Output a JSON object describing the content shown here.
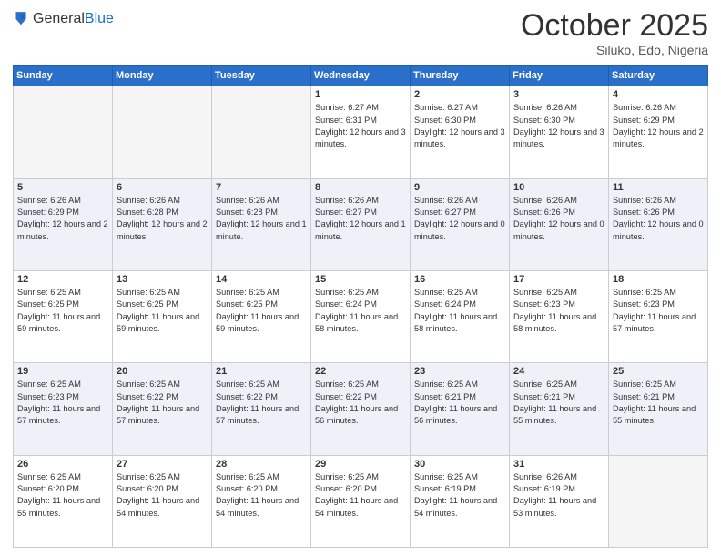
{
  "header": {
    "logo_line1": "General",
    "logo_line2": "Blue",
    "month": "October 2025",
    "location": "Siluko, Edo, Nigeria"
  },
  "weekdays": [
    "Sunday",
    "Monday",
    "Tuesday",
    "Wednesday",
    "Thursday",
    "Friday",
    "Saturday"
  ],
  "weeks": [
    [
      {
        "day": "",
        "sunrise": "",
        "sunset": "",
        "daylight": "",
        "empty": true
      },
      {
        "day": "",
        "sunrise": "",
        "sunset": "",
        "daylight": "",
        "empty": true
      },
      {
        "day": "",
        "sunrise": "",
        "sunset": "",
        "daylight": "",
        "empty": true
      },
      {
        "day": "1",
        "sunrise": "Sunrise: 6:27 AM",
        "sunset": "Sunset: 6:31 PM",
        "daylight": "Daylight: 12 hours and 3 minutes."
      },
      {
        "day": "2",
        "sunrise": "Sunrise: 6:27 AM",
        "sunset": "Sunset: 6:30 PM",
        "daylight": "Daylight: 12 hours and 3 minutes."
      },
      {
        "day": "3",
        "sunrise": "Sunrise: 6:26 AM",
        "sunset": "Sunset: 6:30 PM",
        "daylight": "Daylight: 12 hours and 3 minutes."
      },
      {
        "day": "4",
        "sunrise": "Sunrise: 6:26 AM",
        "sunset": "Sunset: 6:29 PM",
        "daylight": "Daylight: 12 hours and 2 minutes."
      }
    ],
    [
      {
        "day": "5",
        "sunrise": "Sunrise: 6:26 AM",
        "sunset": "Sunset: 6:29 PM",
        "daylight": "Daylight: 12 hours and 2 minutes."
      },
      {
        "day": "6",
        "sunrise": "Sunrise: 6:26 AM",
        "sunset": "Sunset: 6:28 PM",
        "daylight": "Daylight: 12 hours and 2 minutes."
      },
      {
        "day": "7",
        "sunrise": "Sunrise: 6:26 AM",
        "sunset": "Sunset: 6:28 PM",
        "daylight": "Daylight: 12 hours and 1 minute."
      },
      {
        "day": "8",
        "sunrise": "Sunrise: 6:26 AM",
        "sunset": "Sunset: 6:27 PM",
        "daylight": "Daylight: 12 hours and 1 minute."
      },
      {
        "day": "9",
        "sunrise": "Sunrise: 6:26 AM",
        "sunset": "Sunset: 6:27 PM",
        "daylight": "Daylight: 12 hours and 0 minutes."
      },
      {
        "day": "10",
        "sunrise": "Sunrise: 6:26 AM",
        "sunset": "Sunset: 6:26 PM",
        "daylight": "Daylight: 12 hours and 0 minutes."
      },
      {
        "day": "11",
        "sunrise": "Sunrise: 6:26 AM",
        "sunset": "Sunset: 6:26 PM",
        "daylight": "Daylight: 12 hours and 0 minutes."
      }
    ],
    [
      {
        "day": "12",
        "sunrise": "Sunrise: 6:25 AM",
        "sunset": "Sunset: 6:25 PM",
        "daylight": "Daylight: 11 hours and 59 minutes."
      },
      {
        "day": "13",
        "sunrise": "Sunrise: 6:25 AM",
        "sunset": "Sunset: 6:25 PM",
        "daylight": "Daylight: 11 hours and 59 minutes."
      },
      {
        "day": "14",
        "sunrise": "Sunrise: 6:25 AM",
        "sunset": "Sunset: 6:25 PM",
        "daylight": "Daylight: 11 hours and 59 minutes."
      },
      {
        "day": "15",
        "sunrise": "Sunrise: 6:25 AM",
        "sunset": "Sunset: 6:24 PM",
        "daylight": "Daylight: 11 hours and 58 minutes."
      },
      {
        "day": "16",
        "sunrise": "Sunrise: 6:25 AM",
        "sunset": "Sunset: 6:24 PM",
        "daylight": "Daylight: 11 hours and 58 minutes."
      },
      {
        "day": "17",
        "sunrise": "Sunrise: 6:25 AM",
        "sunset": "Sunset: 6:23 PM",
        "daylight": "Daylight: 11 hours and 58 minutes."
      },
      {
        "day": "18",
        "sunrise": "Sunrise: 6:25 AM",
        "sunset": "Sunset: 6:23 PM",
        "daylight": "Daylight: 11 hours and 57 minutes."
      }
    ],
    [
      {
        "day": "19",
        "sunrise": "Sunrise: 6:25 AM",
        "sunset": "Sunset: 6:23 PM",
        "daylight": "Daylight: 11 hours and 57 minutes."
      },
      {
        "day": "20",
        "sunrise": "Sunrise: 6:25 AM",
        "sunset": "Sunset: 6:22 PM",
        "daylight": "Daylight: 11 hours and 57 minutes."
      },
      {
        "day": "21",
        "sunrise": "Sunrise: 6:25 AM",
        "sunset": "Sunset: 6:22 PM",
        "daylight": "Daylight: 11 hours and 57 minutes."
      },
      {
        "day": "22",
        "sunrise": "Sunrise: 6:25 AM",
        "sunset": "Sunset: 6:22 PM",
        "daylight": "Daylight: 11 hours and 56 minutes."
      },
      {
        "day": "23",
        "sunrise": "Sunrise: 6:25 AM",
        "sunset": "Sunset: 6:21 PM",
        "daylight": "Daylight: 11 hours and 56 minutes."
      },
      {
        "day": "24",
        "sunrise": "Sunrise: 6:25 AM",
        "sunset": "Sunset: 6:21 PM",
        "daylight": "Daylight: 11 hours and 55 minutes."
      },
      {
        "day": "25",
        "sunrise": "Sunrise: 6:25 AM",
        "sunset": "Sunset: 6:21 PM",
        "daylight": "Daylight: 11 hours and 55 minutes."
      }
    ],
    [
      {
        "day": "26",
        "sunrise": "Sunrise: 6:25 AM",
        "sunset": "Sunset: 6:20 PM",
        "daylight": "Daylight: 11 hours and 55 minutes."
      },
      {
        "day": "27",
        "sunrise": "Sunrise: 6:25 AM",
        "sunset": "Sunset: 6:20 PM",
        "daylight": "Daylight: 11 hours and 54 minutes."
      },
      {
        "day": "28",
        "sunrise": "Sunrise: 6:25 AM",
        "sunset": "Sunset: 6:20 PM",
        "daylight": "Daylight: 11 hours and 54 minutes."
      },
      {
        "day": "29",
        "sunrise": "Sunrise: 6:25 AM",
        "sunset": "Sunset: 6:20 PM",
        "daylight": "Daylight: 11 hours and 54 minutes."
      },
      {
        "day": "30",
        "sunrise": "Sunrise: 6:25 AM",
        "sunset": "Sunset: 6:19 PM",
        "daylight": "Daylight: 11 hours and 54 minutes."
      },
      {
        "day": "31",
        "sunrise": "Sunrise: 6:26 AM",
        "sunset": "Sunset: 6:19 PM",
        "daylight": "Daylight: 11 hours and 53 minutes."
      },
      {
        "day": "",
        "sunrise": "",
        "sunset": "",
        "daylight": "",
        "empty": true
      }
    ]
  ]
}
